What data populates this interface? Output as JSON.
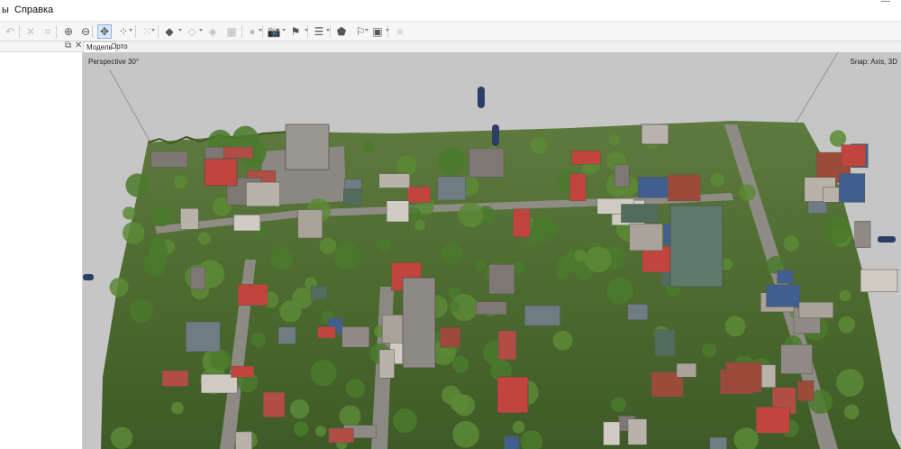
{
  "menubar": {
    "items": [
      "ы",
      "Справка"
    ],
    "window_control": "—"
  },
  "toolbar": {
    "buttons": [
      {
        "icon": "undo-icon",
        "glyph": "↶",
        "enabled": false
      },
      {
        "icon": "delete-icon",
        "glyph": "✕",
        "enabled": false
      },
      {
        "icon": "crop-icon",
        "glyph": "⌗",
        "enabled": false
      },
      {
        "icon": "zoom-in-icon",
        "glyph": "⊕",
        "enabled": true
      },
      {
        "icon": "zoom-out-icon",
        "glyph": "⊖",
        "enabled": true
      },
      {
        "icon": "navigation-icon",
        "glyph": "✥",
        "enabled": true
      },
      {
        "icon": "points-icon",
        "glyph": "⁘",
        "enabled": true
      },
      {
        "icon": "dense-points-icon",
        "glyph": "⁙",
        "enabled": false
      },
      {
        "icon": "mesh-solid-icon",
        "glyph": "◆",
        "enabled": true
      },
      {
        "icon": "mesh-wireframe-icon",
        "glyph": "◇",
        "enabled": false
      },
      {
        "icon": "texture-icon",
        "glyph": "◈",
        "enabled": false
      },
      {
        "icon": "tiled-model-icon",
        "glyph": "▦",
        "enabled": false
      },
      {
        "icon": "sphere-icon",
        "glyph": "●",
        "enabled": false
      },
      {
        "icon": "camera-icon",
        "glyph": "📷",
        "enabled": true
      },
      {
        "icon": "markers-icon",
        "glyph": "⚑",
        "enabled": true
      },
      {
        "icon": "list-icon",
        "glyph": "☰",
        "enabled": true
      },
      {
        "icon": "shapes-icon",
        "glyph": "⬟",
        "enabled": true
      },
      {
        "icon": "flag-icon",
        "glyph": "⚐",
        "enabled": true
      },
      {
        "icon": "image-icon",
        "glyph": "▣",
        "enabled": true
      },
      {
        "icon": "layers-icon",
        "glyph": "≡",
        "enabled": false
      }
    ]
  },
  "tabs": [
    "Модель",
    "Орто"
  ],
  "viewport": {
    "projection_label": "Perspective 30°",
    "snap_label": "Snap: Axis, 3D"
  }
}
